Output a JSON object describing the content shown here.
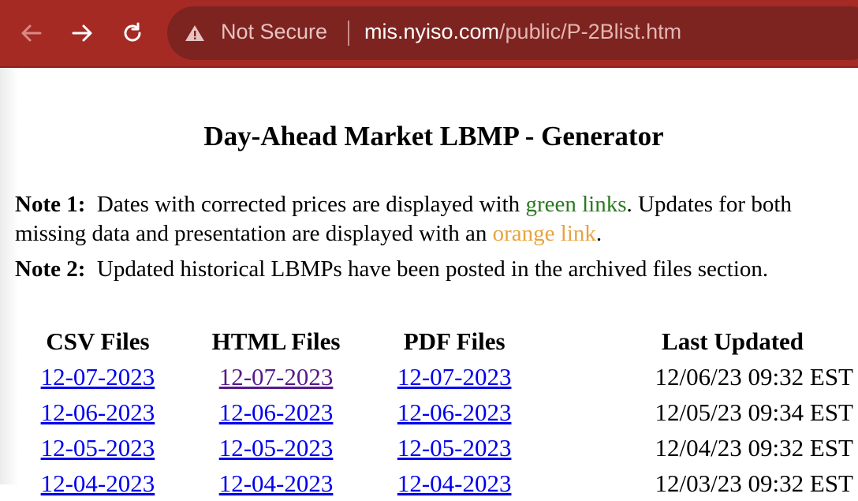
{
  "browser": {
    "security_label": "Not Secure",
    "url_host": "mis.nyiso.com",
    "url_path": "/public/P-2Blist.htm",
    "icons": {
      "back": "back-arrow-icon",
      "forward": "forward-arrow-icon",
      "reload": "reload-icon",
      "warning": "warning-triangle-icon"
    }
  },
  "page": {
    "title": "Day-Ahead Market LBMP - Generator",
    "note1": {
      "label": "Note 1:",
      "text_a": "Dates with corrected prices are displayed with ",
      "green_link": "green links",
      "text_b": ". Updates for both missing data and presentation are displayed with an ",
      "orange_link": "orange link",
      "text_c": "."
    },
    "note2": {
      "label": "Note 2:",
      "text": "Updated historical LBMPs have been posted in the archived files section."
    },
    "table": {
      "headers": [
        "CSV Files",
        "HTML Files",
        "PDF Files",
        "Last Updated"
      ],
      "rows": [
        {
          "csv": "12-07-2023",
          "html": "12-07-2023",
          "pdf": "12-07-2023",
          "updated": "12/06/23 09:32 EST"
        },
        {
          "csv": "12-06-2023",
          "html": "12-06-2023",
          "pdf": "12-06-2023",
          "updated": "12/05/23 09:34 EST"
        },
        {
          "csv": "12-05-2023",
          "html": "12-05-2023",
          "pdf": "12-05-2023",
          "updated": "12/04/23 09:32 EST"
        },
        {
          "csv": "12-04-2023",
          "html": "12-04-2023",
          "pdf": "12-04-2023",
          "updated": "12/03/23 09:32 EST"
        }
      ]
    },
    "colors": {
      "link": "#0000ee",
      "visited_link": "#551a8b",
      "green_link": "#2a7a1f",
      "orange_link": "#e8a23c",
      "toolbar": "#a52a23"
    }
  }
}
